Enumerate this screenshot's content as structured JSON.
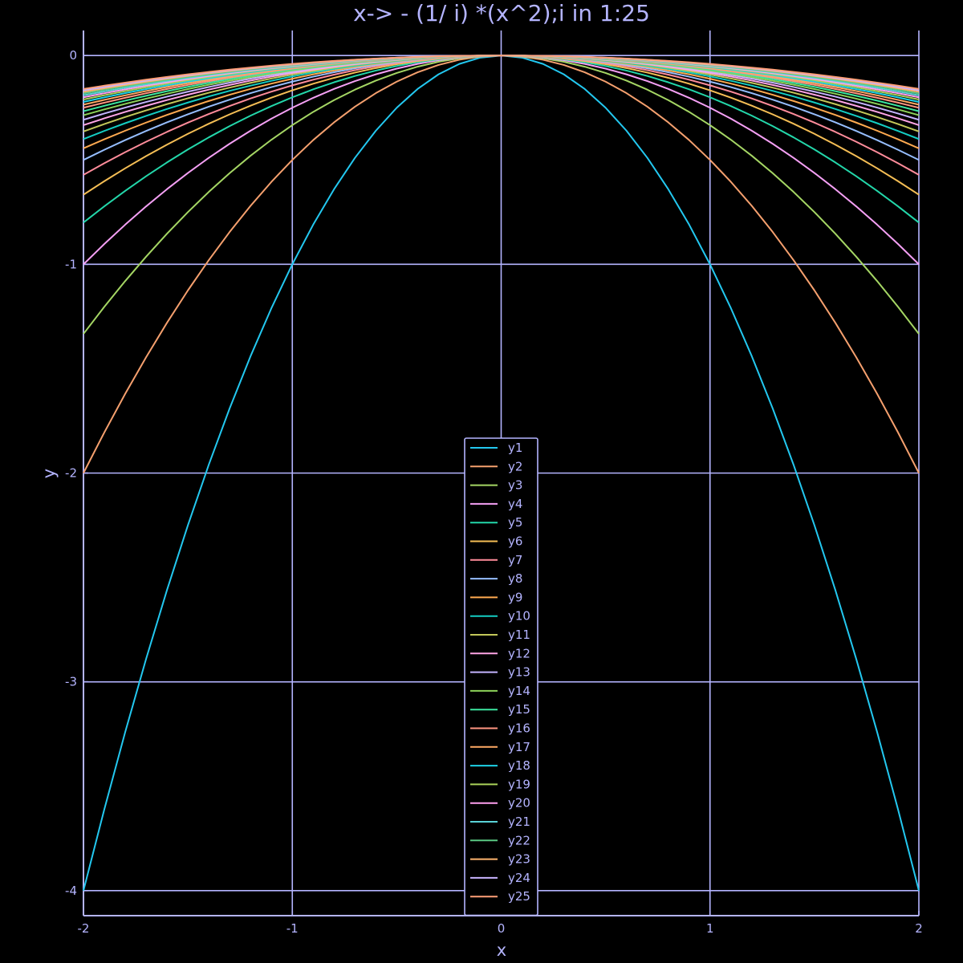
{
  "chart_data": {
    "type": "line",
    "title": "x->  - (1/ i) *(x^2);i in 1:25",
    "xlabel": "x",
    "ylabel": "y",
    "xlim": [
      -2,
      2
    ],
    "ylim": [
      -4.12,
      0.12
    ],
    "xticks": [
      -2,
      -1,
      0,
      1,
      2
    ],
    "yticks": [
      0,
      -1,
      -2,
      -3,
      -4
    ],
    "grid": true,
    "legend_position": "bottom-center",
    "x": [
      -2.0,
      -1.9,
      -1.8,
      -1.7,
      -1.6,
      -1.5,
      -1.4,
      -1.3,
      -1.2,
      -1.1,
      -1.0,
      -0.9,
      -0.8,
      -0.7,
      -0.6,
      -0.5,
      -0.4,
      -0.3,
      -0.2,
      -0.1,
      0.0,
      0.1,
      0.2,
      0.3,
      0.4,
      0.5,
      0.6,
      0.7,
      0.8,
      0.9,
      1.0,
      1.1,
      1.2,
      1.3,
      1.4,
      1.5,
      1.6,
      1.7,
      1.8,
      1.9,
      2.0
    ],
    "series": [
      {
        "name": "y1",
        "i": 1,
        "color": "#23c8f0"
      },
      {
        "name": "y2",
        "i": 2,
        "color": "#f5a06e"
      },
      {
        "name": "y3",
        "i": 3,
        "color": "#a5d664"
      },
      {
        "name": "y4",
        "i": 4,
        "color": "#f5a0f5"
      },
      {
        "name": "y5",
        "i": 5,
        "color": "#23d7aa"
      },
      {
        "name": "y6",
        "i": 6,
        "color": "#f5be55"
      },
      {
        "name": "y7",
        "i": 7,
        "color": "#ff8c9b"
      },
      {
        "name": "y8",
        "i": 8,
        "color": "#96beff"
      },
      {
        "name": "y9",
        "i": 9,
        "color": "#ffaa50"
      },
      {
        "name": "y10",
        "i": 10,
        "color": "#14cdc3"
      },
      {
        "name": "y11",
        "i": 11,
        "color": "#c3c85a"
      },
      {
        "name": "y12",
        "i": 12,
        "color": "#ffa5e6"
      },
      {
        "name": "y13",
        "i": 13,
        "color": "#c3b4ff"
      },
      {
        "name": "y14",
        "i": 14,
        "color": "#8cd25a"
      },
      {
        "name": "y15",
        "i": 15,
        "color": "#3ce6a0"
      },
      {
        "name": "y16",
        "i": 16,
        "color": "#ff9682"
      },
      {
        "name": "y17",
        "i": 17,
        "color": "#ffaa64"
      },
      {
        "name": "y18",
        "i": 18,
        "color": "#1ed2e6"
      },
      {
        "name": "y19",
        "i": 19,
        "color": "#aad25a"
      },
      {
        "name": "y20",
        "i": 20,
        "color": "#ffa0f0"
      },
      {
        "name": "y21",
        "i": 21,
        "color": "#5ad2d7"
      },
      {
        "name": "y22",
        "i": 22,
        "color": "#5ac882"
      },
      {
        "name": "y23",
        "i": 23,
        "color": "#ffb46e"
      },
      {
        "name": "y24",
        "i": 24,
        "color": "#c8b4ff"
      },
      {
        "name": "y25",
        "i": 25,
        "color": "#ffa078"
      }
    ]
  },
  "colors": {
    "background": "#000000",
    "axes": "#b4b4ff",
    "grid": "#b4b4ff",
    "text": "#b4b4ff"
  }
}
